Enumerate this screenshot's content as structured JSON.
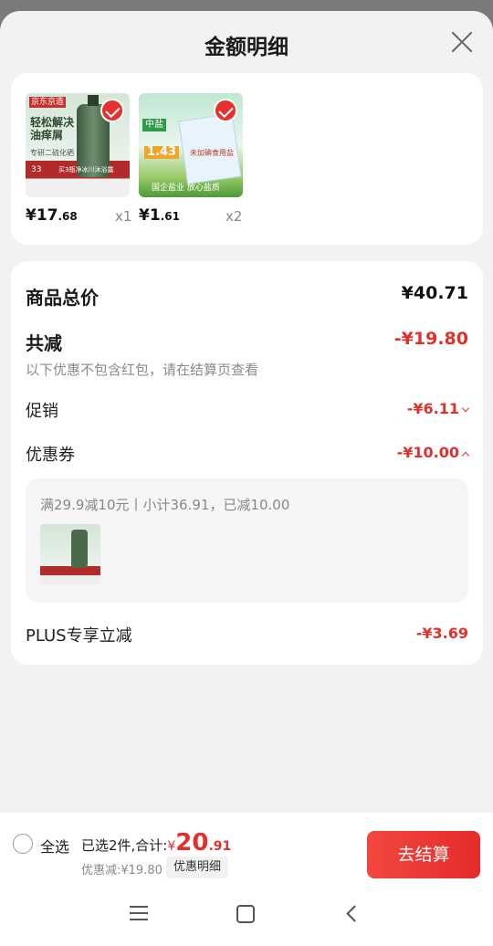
{
  "modal": {
    "title": "金额明细"
  },
  "products": [
    {
      "price_int": "¥17",
      "price_dec": ".68",
      "qty": "x1",
      "img_texts": [
        "京东京造",
        "轻松解决",
        "油痒屑",
        "专研二硫化硒",
        "33",
        "买3瓶净冰川沐浴露"
      ]
    },
    {
      "price_int": "¥1",
      "price_dec": ".61",
      "qty": "x2",
      "img_texts": [
        "中盐",
        "1.43",
        "未加碘食用盐",
        "国企盐业 放心盐质"
      ]
    }
  ],
  "summary": {
    "total_label": "商品总价",
    "total_value": "¥40.71",
    "reduce_label": "共减",
    "reduce_value": "-¥19.80",
    "reduce_note": "以下优惠不包含红包，请在结算页查看",
    "promo_label": "促销",
    "promo_value": "-¥6.11",
    "coupon_label": "优惠券",
    "coupon_value": "-¥10.00",
    "coupon_detail": "满29.9减10元丨小计36.91，已减10.00",
    "plus_label": "PLUS专享立减",
    "plus_value": "-¥3.69"
  },
  "bottom": {
    "select_all": "全选",
    "selected_text": "已选2件,合计:",
    "yen": "¥",
    "total_int": "20",
    "total_dec": ".91",
    "discount_text": "优惠减:¥19.80",
    "detail_button": "优惠明细",
    "checkout_button": "去结算"
  },
  "colors": {
    "accent": "#e0322d",
    "button": "#e62b2b"
  },
  "icons": [
    "close-icon",
    "check-icon",
    "menu-icon",
    "home-icon",
    "back-icon"
  ]
}
